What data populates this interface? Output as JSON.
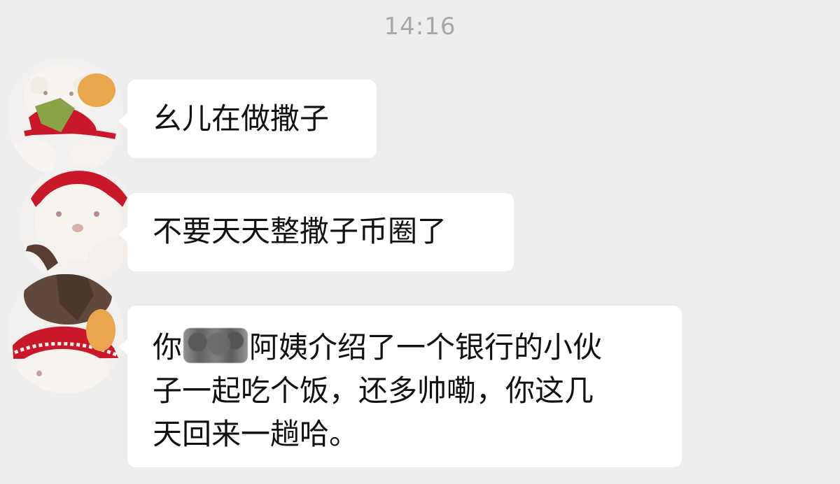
{
  "timestamp": "14:16",
  "messages": [
    {
      "lines": [
        "幺儿在做撒子"
      ]
    },
    {
      "lines": [
        "不要天天整撒子币圈了"
      ]
    },
    {
      "lines": [
        "你",
        "阿姨介绍了一个银行的小伙",
        "子一起吃个饭，还多帅嘞，你这几",
        "天回来一趟哈。"
      ]
    }
  ],
  "avatar_icon": "plush-bear-avatar",
  "colors": {
    "background": "#ededed",
    "bubble": "#ffffff",
    "text": "#111111",
    "timestamp": "#a8a8a8",
    "accent_red": "#c9182a"
  }
}
